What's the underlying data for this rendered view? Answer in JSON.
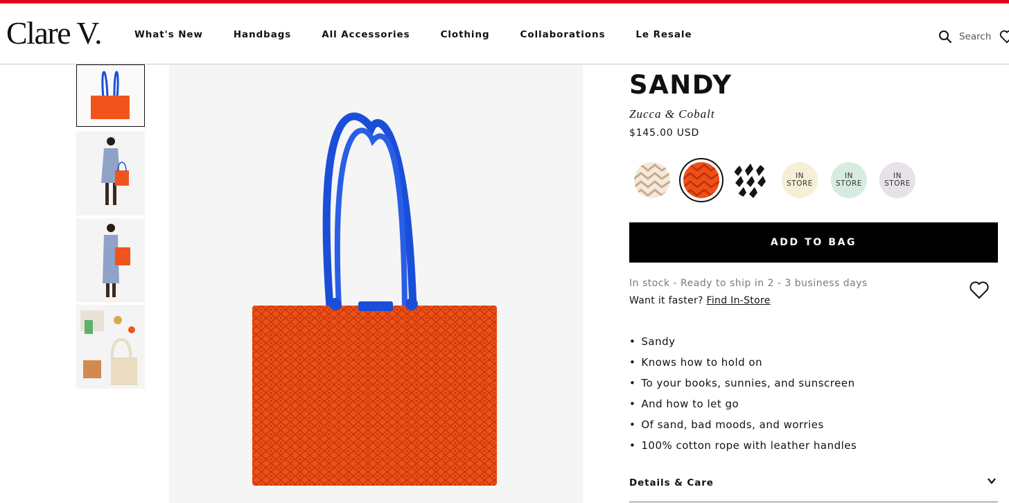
{
  "brand": {
    "logo_text": "Clare V."
  },
  "nav": {
    "items": [
      "What's New",
      "Handbags",
      "All Accessories",
      "Clothing",
      "Collaborations",
      "Le Resale"
    ],
    "search_label": "Search"
  },
  "icons": {
    "search": "search-icon",
    "wishlist_header": "heart-icon",
    "wishlist": "heart-outline-icon",
    "details_toggle": "chevron-down-icon"
  },
  "colors": {
    "accent_stripe": "#e1061b",
    "bag_orange": "#f0541c",
    "handle_blue": "#1b4ed8",
    "button_black": "#000000"
  },
  "product": {
    "name": "SANDY",
    "color_name": "Zucca & Cobalt",
    "price": "$145.00 USD",
    "swatches": [
      {
        "name": "natural",
        "label": "",
        "selected": false
      },
      {
        "name": "zucca-cobalt",
        "label": "",
        "selected": true
      },
      {
        "name": "black-white",
        "label": "",
        "selected": false
      },
      {
        "name": "cream",
        "label": "IN STORE",
        "line1": "IN",
        "line2": "STORE",
        "selected": false
      },
      {
        "name": "mint",
        "label": "IN STORE",
        "line1": "IN",
        "line2": "STORE",
        "selected": false
      },
      {
        "name": "lavender",
        "label": "IN STORE",
        "line1": "IN",
        "line2": "STORE",
        "selected": false
      }
    ],
    "add_to_bag": "ADD TO BAG",
    "stock_status": "In stock - Ready to ship in 2 - 3 business days",
    "faster_prefix": "Want it faster?",
    "find_in_store": "Find In-Store",
    "bullets": [
      "Sandy",
      "Knows how to hold on",
      "To your books, sunnies, and sunscreen",
      "And how to let go",
      "Of sand, bad moods, and worries",
      "100% cotton rope with leather handles"
    ],
    "details_label": "Details & Care"
  }
}
